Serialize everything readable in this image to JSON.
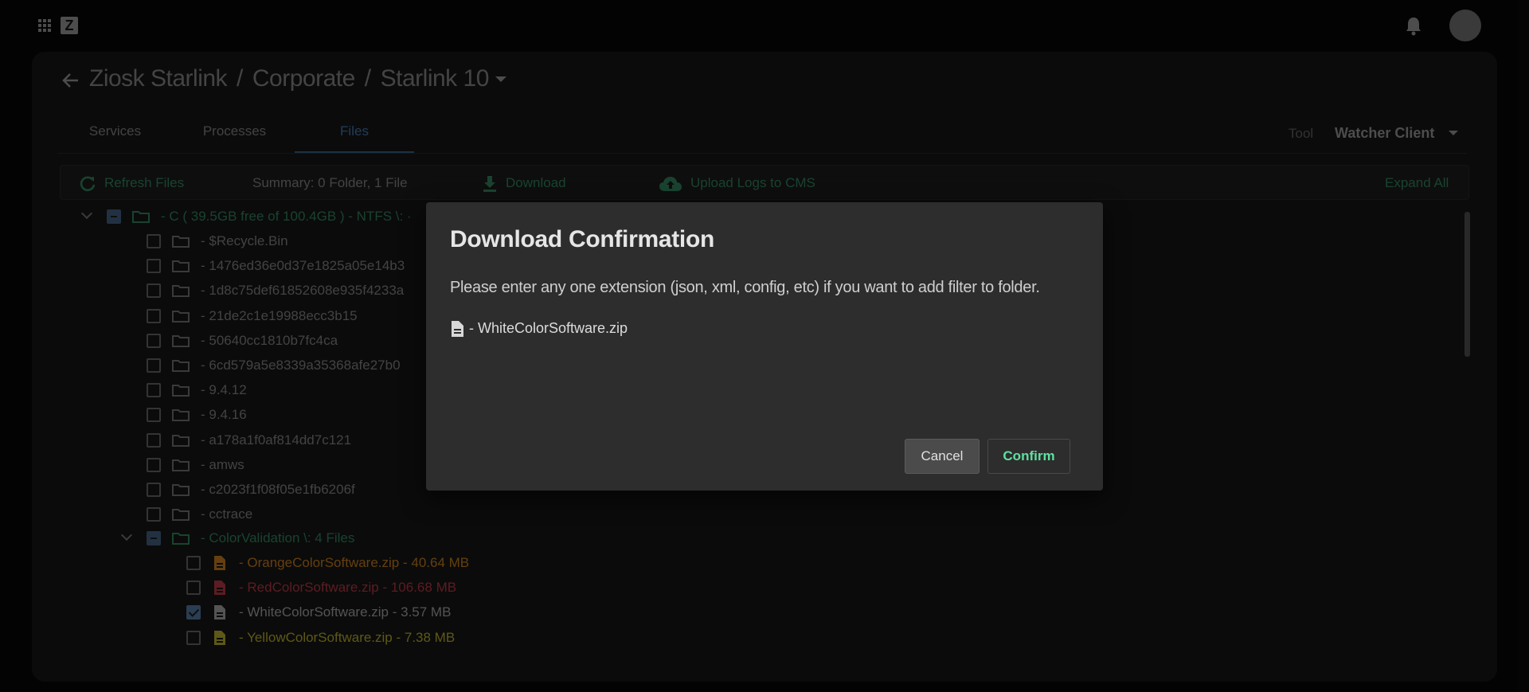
{
  "header": {
    "logo_letter": "Z",
    "icons": [
      "apps-grid-icon",
      "bell-icon",
      "user-avatar"
    ]
  },
  "breadcrumb": {
    "items": [
      "Ziosk Starlink",
      "Corporate",
      "Starlink 10"
    ],
    "separator": "/"
  },
  "tabs": [
    {
      "label": "Services",
      "active": false
    },
    {
      "label": "Processes",
      "active": false
    },
    {
      "label": "Files",
      "active": true
    }
  ],
  "tool": {
    "label": "Tool",
    "value": "Watcher Client"
  },
  "toolbar": {
    "refresh_label": "Refresh Files",
    "summary": "Summary: 0 Folder, 1 File",
    "download_label": "Download",
    "upload_label": "Upload Logs to CMS",
    "expand_label": "Expand All"
  },
  "tree": {
    "drive": {
      "label": "-  C ( 39.5GB free of 100.4GB ) - NTFS \\:  ·",
      "state": "indeterminate"
    },
    "folders": [
      {
        "label": "-  $Recycle.Bin"
      },
      {
        "label": "-  1476ed36e0d37e1825a05e14b3"
      },
      {
        "label": "-  1d8c75def61852608e935f4233a"
      },
      {
        "label": "-  21de2c1e19988ecc3b15"
      },
      {
        "label": "-  50640cc1810b7fc4ca"
      },
      {
        "label": "-  6cd579a5e8339a35368afe27b0"
      },
      {
        "label": "-  9.4.12"
      },
      {
        "label": "-  9.4.16"
      },
      {
        "label": "-  a178a1f0af814dd7c121"
      },
      {
        "label": "-  amws"
      },
      {
        "label": "-  c2023f1f08f05e1fb6206f"
      },
      {
        "label": "-  cctrace"
      }
    ],
    "expanded_folder": {
      "label": "-  ColorValidation \\:   4 Files",
      "state": "indeterminate"
    },
    "files": [
      {
        "label": "-  OrangeColorSoftware.zip  -  40.64 MB",
        "color": "#b8741c",
        "checked": false
      },
      {
        "label": "-  RedColorSoftware.zip  -  106.68 MB",
        "color": "#a8333f",
        "checked": false
      },
      {
        "label": "-  WhiteColorSoftware.zip  -  3.57 MB",
        "color": "#9a9a9a",
        "checked": true
      },
      {
        "label": "-  YellowColorSoftware.zip  -  7.38 MB",
        "color": "#a9a02a",
        "checked": false
      }
    ]
  },
  "dialog": {
    "title": "Download Confirmation",
    "message": "Please enter any one extension (json, xml, config, etc) if you want to add filter to folder.",
    "file_label": "-  WhiteColorSoftware.zip",
    "cancel_label": "Cancel",
    "confirm_label": "Confirm"
  },
  "colors": {
    "accent_green": "#2f7a58",
    "tab_active": "#3d6ea3",
    "confirm_text": "#5ee0a0"
  }
}
